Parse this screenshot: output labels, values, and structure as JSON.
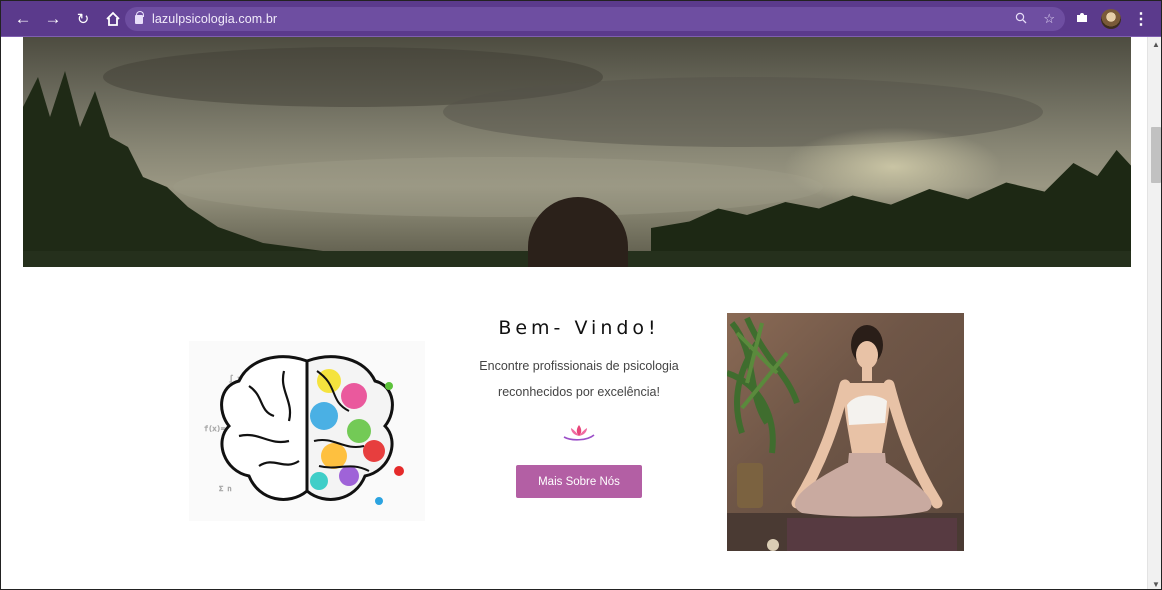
{
  "browser": {
    "url": "lazulpsicologia.com.br",
    "nav_icons": [
      "back-arrow-icon",
      "forward-arrow-icon",
      "reload-icon",
      "home-icon"
    ],
    "theme_color": "#5b3a8c"
  },
  "welcome": {
    "title": "Bem- Vindo!",
    "description_line1": "Encontre profissionais de psicologia",
    "description_line2": "reconhecidos por excelência!",
    "button_label": "Mais Sobre Nós",
    "button_color": "#b35fa4"
  },
  "images": {
    "hero": "forest-lake-woman-hero-photo",
    "left": "colorful-brain-illustration",
    "right": "woman-meditating-yoga-photo"
  }
}
